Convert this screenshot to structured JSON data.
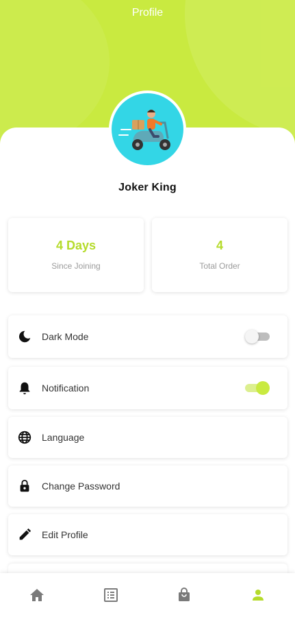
{
  "header": {
    "title": "Profile"
  },
  "profile": {
    "name": "Joker King"
  },
  "stats": [
    {
      "value": "4 Days",
      "label": "Since Joining"
    },
    {
      "value": "4",
      "label": "Total Order"
    }
  ],
  "settings": [
    {
      "icon": "moon-icon",
      "label": "Dark Mode",
      "toggle": false
    },
    {
      "icon": "bell-icon",
      "label": "Notification",
      "toggle": true
    },
    {
      "icon": "globe-icon",
      "label": "Language"
    },
    {
      "icon": "lock-icon",
      "label": "Change Password"
    },
    {
      "icon": "pencil-icon",
      "label": "Edit Profile"
    }
  ],
  "bottom_nav": [
    {
      "icon": "home-icon",
      "active": false
    },
    {
      "icon": "list-icon",
      "active": false
    },
    {
      "icon": "shopping-bag-icon",
      "active": false
    },
    {
      "icon": "person-icon",
      "active": true
    }
  ],
  "colors": {
    "accent": "#c9ea40",
    "accent_text": "#b5db2b",
    "avatar_bg": "#33d6e6",
    "nav_inactive": "#7a7a7a"
  }
}
